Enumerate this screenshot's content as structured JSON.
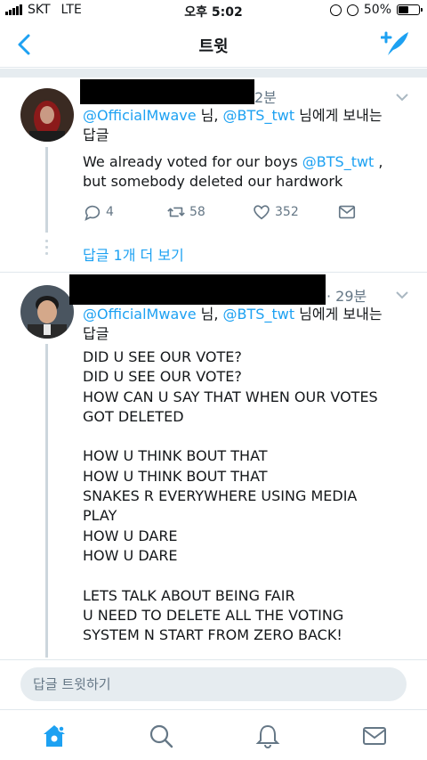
{
  "status_bar": {
    "carrier": "SKT",
    "network": "LTE",
    "time": "오후 5:02",
    "battery": "50%",
    "battery_level": 0.5
  },
  "nav": {
    "title": "트윗"
  },
  "tweets": [
    {
      "time": "2분",
      "reply_prefix": "",
      "reply_handle_1": "@OfficialMwave",
      "reply_sep": " 님, ",
      "reply_handle_2": "@BTS_twt",
      "reply_suffix": " 님에게 보내는",
      "reply_line2": "답글",
      "text_1": "We already voted for our boys ",
      "text_link": "@BTS_twt",
      "text_2": " ,\nbut somebody deleted our hardwork",
      "replies": "4",
      "retweets": "58",
      "likes": "352",
      "more_replies": "답글 1개 더 보기"
    },
    {
      "time": "· 29분",
      "reply_handle_1": "@OfficialMwave",
      "reply_sep": " 님, ",
      "reply_handle_2": "@BTS_twt",
      "reply_suffix": " 님에게 보내는",
      "reply_line2": "답글",
      "text": "DID U SEE OUR VOTE?\nDID U SEE OUR VOTE?\nHOW CAN U SAY THAT WHEN OUR VOTES\nGOT DELETED\n\nHOW U THINK BOUT THAT\nHOW U THINK BOUT THAT\nSNAKES R EVERYWHERE USING MEDIA\nPLAY\nHOW U DARE\nHOW U DARE\n\nLETS TALK ABOUT BEING FAIR\nU NEED TO DELETE ALL THE VOTING\nSYSTEM N START FROM ZERO BACK!"
    }
  ],
  "reply_bar": {
    "placeholder": "답글 트윗하기"
  },
  "tabs": [
    "home-icon",
    "search-icon",
    "notifications-icon",
    "messages-icon"
  ],
  "colors": {
    "accent": "#1da1f2",
    "muted": "#657786",
    "divider": "#e6ecf0"
  }
}
